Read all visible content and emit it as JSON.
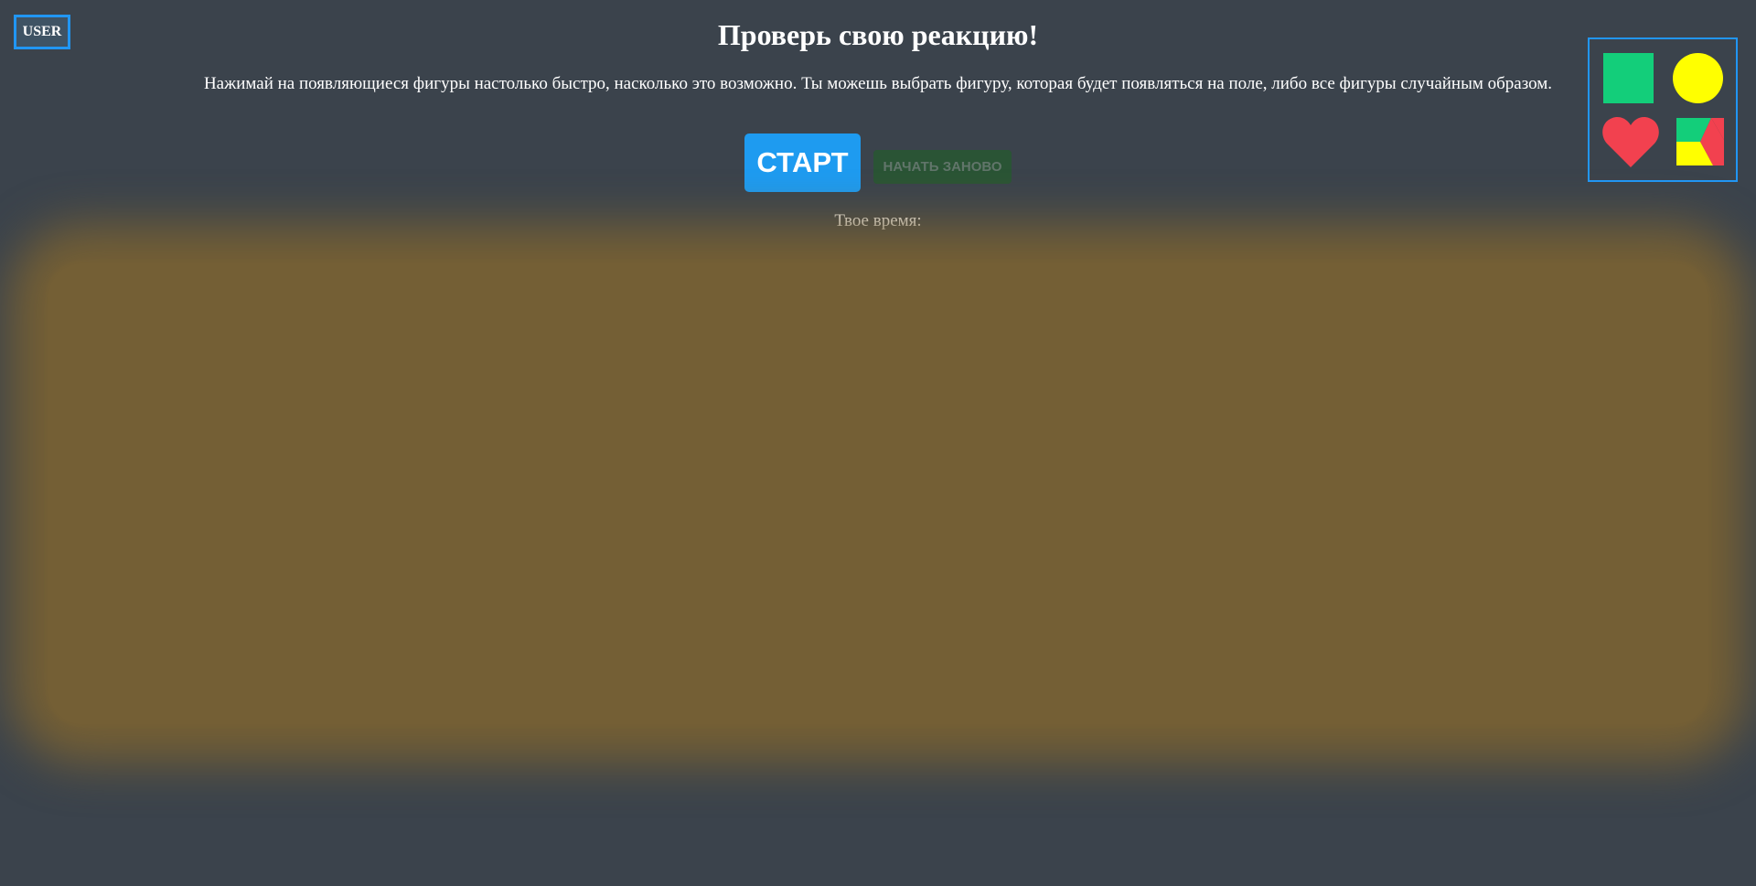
{
  "header": {
    "user_label": "USER",
    "title": "Проверь свою реакцию!",
    "description": "Нажимай на появляющиеся фигуры настолько быстро, насколько это возможно. Ты можешь выбрать фигуру, которая будет появляться на поле, либо все фигуры случайным образом."
  },
  "controls": {
    "start_label": "СТАРТ",
    "restart_label": "НАЧАТЬ ЗАНОВО",
    "time_label": "Твое время:"
  },
  "shape_picker": {
    "options": [
      {
        "icon": "square-icon",
        "color": "#13ce7a"
      },
      {
        "icon": "circle-icon",
        "color": "#ffff00"
      },
      {
        "icon": "heart-icon",
        "color": "#f2414f"
      },
      {
        "icon": "random-shapes-icon",
        "colors": [
          "#13ce7a",
          "#ffff00",
          "#f2414f"
        ]
      }
    ]
  },
  "colors": {
    "background": "#3b434c",
    "accent": "#2196f3",
    "start_button": "#1e9bf0",
    "restart_button": "#2a5435",
    "game_field": "#745f35"
  }
}
